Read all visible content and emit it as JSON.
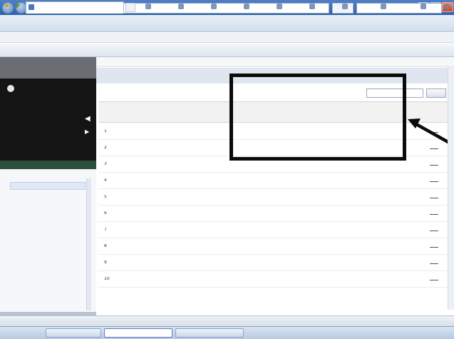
{
  "window": {
    "title": ""
  },
  "address_bar": {
    "url": "",
    "search_placeholder": ""
  },
  "menu": [
    "",
    "",
    "",
    "",
    "",
    ""
  ],
  "tabbar": {
    "active_tab": "",
    "commands": [
      "",
      "",
      "",
      "",
      "",
      "",
      "",
      "",
      ""
    ]
  },
  "left_panel": {
    "header_line1": "",
    "header_line2": "",
    "user_label": "",
    "tabs": [
      "",
      ""
    ],
    "tree_root": "",
    "tree_child": "",
    "tree_child_value": ""
  },
  "content_toolbar": [
    "",
    "",
    "",
    "",
    "",
    "",
    "",
    "",
    "",
    "",
    "",
    "",
    "",
    ""
  ],
  "pager": "",
  "search": {
    "label": "",
    "button": ""
  },
  "table": {
    "columns": [
      "",
      "",
      "",
      "",
      "",
      "",
      "",
      "",
      ""
    ],
    "subheaders": [
      "",
      "",
      "",
      "",
      ""
    ],
    "rows": [
      {
        "no": "1",
        "cells": [
          "",
          "",
          "",
          "",
          "",
          "",
          "",
          "",
          ""
        ]
      },
      {
        "no": "2",
        "cells": [
          "",
          "",
          "",
          "",
          "",
          "",
          "",
          "",
          ""
        ]
      },
      {
        "no": "3",
        "cells": [
          "",
          "",
          "",
          "",
          "",
          "",
          "",
          "",
          ""
        ]
      },
      {
        "no": "4",
        "cells": [
          "",
          "",
          "",
          "",
          "",
          "",
          "",
          "",
          ""
        ]
      },
      {
        "no": "5",
        "cells": [
          "",
          "",
          "",
          "",
          "",
          "",
          "",
          "",
          ""
        ]
      },
      {
        "no": "6",
        "cells": [
          "",
          "",
          "",
          "",
          "",
          "",
          "",
          "",
          ""
        ]
      },
      {
        "no": "7",
        "cells": [
          "",
          "",
          "",
          "",
          "",
          "",
          "",
          "",
          ""
        ]
      },
      {
        "no": "8",
        "cells": [
          "",
          "",
          "",
          "",
          "",
          "",
          "",
          "",
          ""
        ]
      },
      {
        "no": "9",
        "cells": [
          "",
          "",
          "",
          "",
          "",
          "",
          "",
          "",
          ""
        ]
      },
      {
        "no": "10",
        "cells": [
          "",
          "",
          "",
          "",
          "",
          "",
          "",
          "",
          ""
        ]
      }
    ]
  },
  "statusbar": {
    "text": "",
    "zone": "",
    "zoom": ""
  },
  "taskbar": {
    "start": "",
    "tasks": [
      "",
      "",
      ""
    ],
    "tray": ""
  }
}
